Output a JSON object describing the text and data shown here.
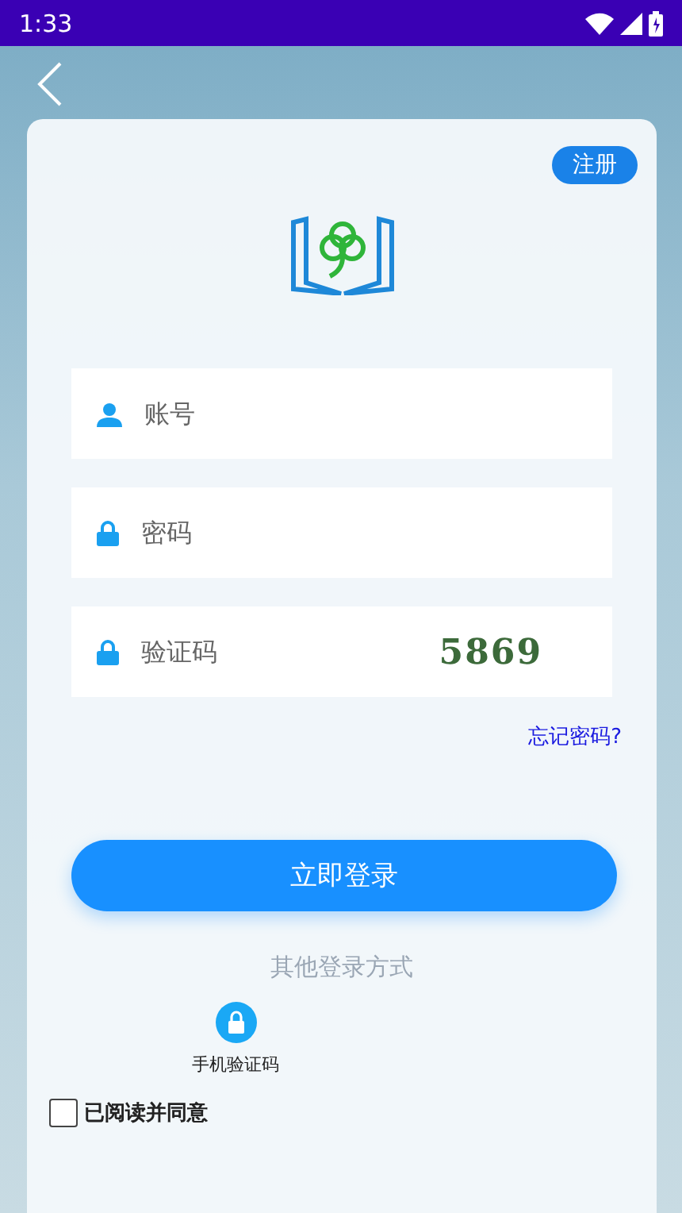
{
  "status_bar": {
    "time": "1:33"
  },
  "register_button": "注册",
  "fields": [
    {
      "kind": "user",
      "placeholder": "账号"
    },
    {
      "kind": "lock",
      "placeholder": "密码"
    },
    {
      "kind": "captcha",
      "placeholder": "验证码",
      "captcha": "5869"
    }
  ],
  "forgot_link": "忘记密码?",
  "login_button": "立即登录",
  "other_title": "其他登录方式",
  "other_methods": [
    {
      "label": "手机验证码"
    }
  ],
  "agreement": {
    "checked": false,
    "text": "已阅读并同意"
  }
}
